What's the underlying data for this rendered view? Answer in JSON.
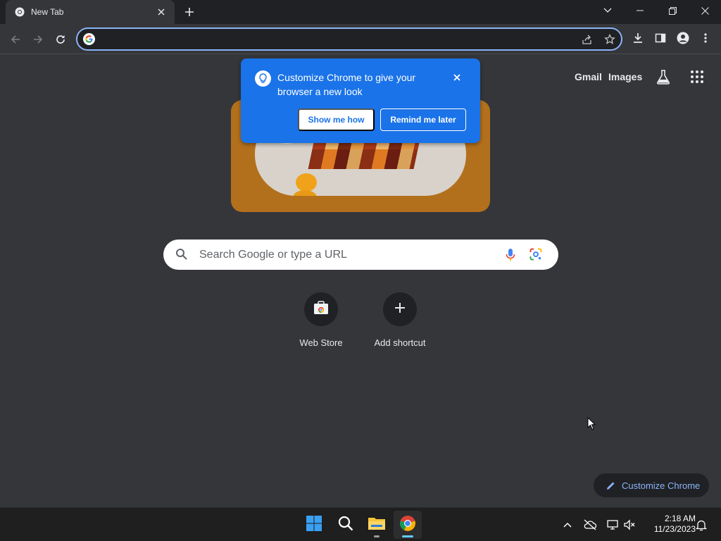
{
  "tab": {
    "title": "New Tab"
  },
  "omnibox": {
    "value": ""
  },
  "header_links": {
    "gmail": "Gmail",
    "images": "Images"
  },
  "promo": {
    "message": "Customize Chrome to give your browser a new look",
    "primary_button": "Show me how",
    "secondary_button": "Remind me later"
  },
  "search": {
    "placeholder": "Search Google or type a URL"
  },
  "shortcuts": [
    {
      "label": "Web Store"
    },
    {
      "label": "Add shortcut"
    }
  ],
  "customize_button": {
    "label": "Customize Chrome"
  },
  "taskbar": {
    "apps": [
      "start-icon",
      "search-icon",
      "file-explorer-icon",
      "chrome-icon"
    ],
    "time": "2:18 AM",
    "date": "11/23/2023"
  },
  "colors": {
    "accent": "#1a73e8",
    "link_blue": "#8ab4f8",
    "page_bg": "#35363a",
    "doodle_bg": "#b3701c"
  }
}
